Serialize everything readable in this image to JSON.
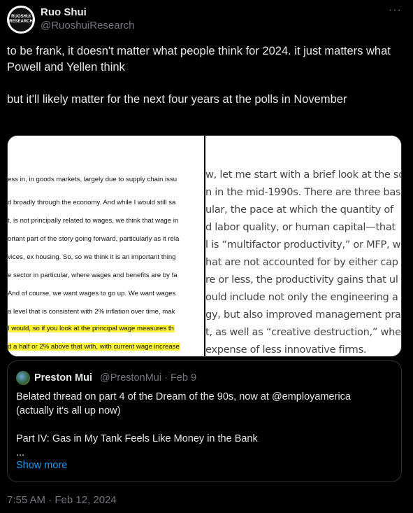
{
  "author": {
    "name": "Ruo Shui",
    "handle": "@RuoshuiResearch",
    "avatar_text": "RUOSHUI RESEARCH",
    "more_icon": "ellipsis-icon"
  },
  "tweet": {
    "paragraphs": [
      "to be frank, it doesn't matter what people think for 2024. it just matters what Powell and Yellen think",
      "but it'll likely matter for the next four years at the polls in November"
    ],
    "timestamp": "7:55 AM · Feb 12, 2024"
  },
  "media": {
    "left_lines": [
      {
        "text": "ess in, in goods markets, largely due to supply chain issu",
        "highlight": false
      },
      {
        "text": "d broadly through the economy. And while I would still sa",
        "highlight": false
      },
      {
        "text": "t, is not principally related to wages, we think that wage in",
        "highlight": false
      },
      {
        "text": "ortant part of the story going forward, particularly as it rela",
        "highlight": false
      },
      {
        "text": "vices, ex housing. So, so we think it is an important thing",
        "highlight": false
      },
      {
        "text": "e sector in particular, where wages and benefits are by fa",
        "highlight": false
      },
      {
        "text": "And of course, we want wages to go up. We want wages",
        "highlight": false
      },
      {
        "text": "a level that is consistent with 2% inflation over time, mak",
        "highlight": false
      },
      {
        "text": "I would, so if you look at the principal wage measures th",
        "highlight": true
      },
      {
        "text": "d a half or 2% above that with, with current wage increase",
        "highlight": true
      }
    ],
    "right_lines": [
      "w, let me start with a brief look at the so",
      "n in the mid-1990s. There are three bas",
      "ular, the pace at which the quantity of",
      "d labor quality, or human capital—that",
      "l is “multifactor productivity,” or MFP, wh",
      "hat are not accounted for by either cap",
      "re or less, the productivity gains that ul",
      "ould include not only the engineering a",
      "gy, but also improved management pra",
      "t, as well as “creative destruction,” whe",
      "expense of less innovative firms."
    ]
  },
  "quote": {
    "name": "Preston Mui",
    "meta": "@PrestonMui · Feb 9",
    "lines": [
      "Belated thread on part 4 of the Dream of the 90s, now at @employamerica",
      "(actually it's all up now)",
      "",
      "Part IV: Gas in My Tank Feels Like Money in the Bank",
      "..."
    ],
    "show_more": "Show more"
  }
}
